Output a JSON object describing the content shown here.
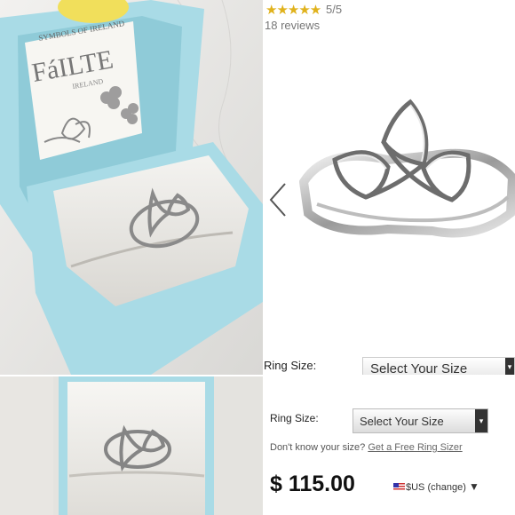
{
  "product": {
    "stars": "★★★★★",
    "rating": "5/5",
    "reviews": "18 reviews",
    "price": "$ 115.00",
    "currency_label": "$US (change)",
    "currency_caret": "▼"
  },
  "size_selector_top": {
    "label": "Ring Size:",
    "placeholder": "Select Your Size",
    "caret": "▾"
  },
  "size_selector_bottom": {
    "label": "Ring Size:",
    "placeholder": "Select Your Size",
    "caret": "▾",
    "help_text": "Don't know your size?",
    "help_link": "Get a Free Ring Sizer"
  },
  "box_card": {
    "brand": "FáILTE",
    "sub": "IRELAND",
    "top_text": "SYMBOLS OF IRELAND"
  },
  "colors": {
    "box_blue": "#a9dbe6",
    "star_gold": "#e0b21c",
    "cushion": "#ecebe7"
  },
  "icons": [
    "chevron-left-icon",
    "us-flag-icon",
    "dropdown-caret-icon"
  ]
}
